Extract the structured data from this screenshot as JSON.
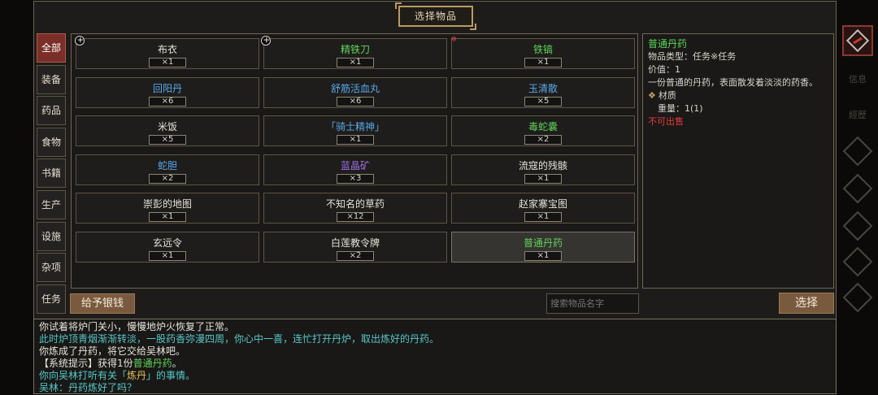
{
  "title": "选择物品",
  "tabs": [
    "全部",
    "装备",
    "药品",
    "食物",
    "书籍",
    "生产",
    "设施",
    "杂项",
    "任务"
  ],
  "active_tab": 0,
  "items": [
    {
      "name": "布衣",
      "qty": "×1",
      "color": "white"
    },
    {
      "name": "精铁刀",
      "qty": "×1",
      "color": "green"
    },
    {
      "name": "铁镐",
      "qty": "×1",
      "color": "green"
    },
    {
      "name": "回阳丹",
      "qty": "×6",
      "color": "blue"
    },
    {
      "name": "舒筋活血丸",
      "qty": "×6",
      "color": "blue"
    },
    {
      "name": "玉清散",
      "qty": "×5",
      "color": "blue"
    },
    {
      "name": "米饭",
      "qty": "×5",
      "color": "white"
    },
    {
      "name": "「骑士精神」",
      "qty": "×1",
      "color": "blue"
    },
    {
      "name": "毒蛇囊",
      "qty": "×2",
      "color": "green"
    },
    {
      "name": "蛇胆",
      "qty": "×2",
      "color": "blue"
    },
    {
      "name": "蓝晶矿",
      "qty": "×3",
      "color": "purple"
    },
    {
      "name": "流寇的残骸",
      "qty": "×1",
      "color": "white"
    },
    {
      "name": "崇彭的地图",
      "qty": "×1",
      "color": "white"
    },
    {
      "name": "不知名的草药",
      "qty": "×12",
      "color": "white"
    },
    {
      "name": "赵家寨宝图",
      "qty": "×1",
      "color": "white"
    },
    {
      "name": "玄远令",
      "qty": "×1",
      "color": "white"
    },
    {
      "name": "白莲教令牌",
      "qty": "×2",
      "color": "white"
    },
    {
      "name": "普通丹药",
      "qty": "×1",
      "color": "green"
    }
  ],
  "selected_index": 17,
  "detail": {
    "name": "普通丹药",
    "type": "物品类型：任务※任务",
    "value": "价值：1",
    "desc": "一份普通的丹药，表面散发着淡淡的药香。",
    "material_label": "材质",
    "weight": "重量：1(1)",
    "unsellable": "不可出售"
  },
  "buttons": {
    "give": "给予银钱",
    "select": "选择"
  },
  "search_placeholder": "搜索物品名字",
  "log": [
    {
      "text": "你试着将炉门关小，慢慢地炉火恢复了正常。",
      "cls": "w"
    },
    {
      "text": "此时炉顶青烟渐渐转淡，一股药香弥漫四周，你心中一喜，连忙打开丹炉，取出炼好的丹药。",
      "cls": "c"
    },
    {
      "text": "你炼成了丹药，将它交给吴林吧。",
      "cls": "w"
    },
    {
      "parts": [
        {
          "text": "【系统提示】获得1份",
          "cls": "w"
        },
        {
          "text": "普通丹药",
          "cls": "g"
        },
        {
          "text": "。",
          "cls": "w"
        }
      ]
    },
    {
      "parts": [
        {
          "text": "你向吴林打听有关「",
          "cls": "c"
        },
        {
          "text": "炼丹",
          "cls": "o"
        },
        {
          "text": "」的事情。",
          "cls": "c"
        }
      ]
    },
    {
      "text": "吴林：丹药炼好了吗？",
      "cls": "c"
    }
  ],
  "sidebar": [
    "信息",
    "經歷"
  ]
}
